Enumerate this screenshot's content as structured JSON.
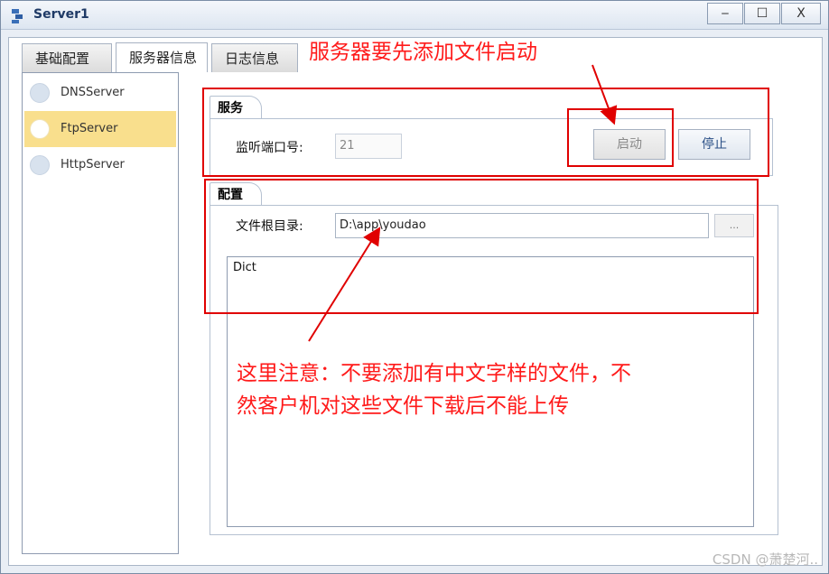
{
  "window": {
    "title": "Server1",
    "min_glyph": "‒",
    "max_glyph": "☐",
    "close_glyph": "X"
  },
  "tabs": [
    {
      "label": "基础配置"
    },
    {
      "label": "服务器信息"
    },
    {
      "label": "日志信息"
    }
  ],
  "servers": [
    {
      "label": "DNSServer",
      "selected": false
    },
    {
      "label": "FtpServer",
      "selected": true
    },
    {
      "label": "HttpServer",
      "selected": false
    }
  ],
  "service": {
    "group_title": "服务",
    "port_label": "监听端口号:",
    "port_value": "21",
    "start_label": "启动",
    "stop_label": "停止"
  },
  "config": {
    "group_title": "配置",
    "root_label": "文件根目录:",
    "root_value": "D:\\app\\youdao",
    "browse_label": "...",
    "files": [
      "Dict"
    ]
  },
  "annotations": {
    "top": "服务器要先添加文件启动",
    "note_line1": "这里注意：不要添加有中文字样的文件，不",
    "note_line2": "然客户机对这些文件下载后不能上传",
    "color": "#ff1a1a"
  },
  "watermark": "CSDN @萧楚河.."
}
